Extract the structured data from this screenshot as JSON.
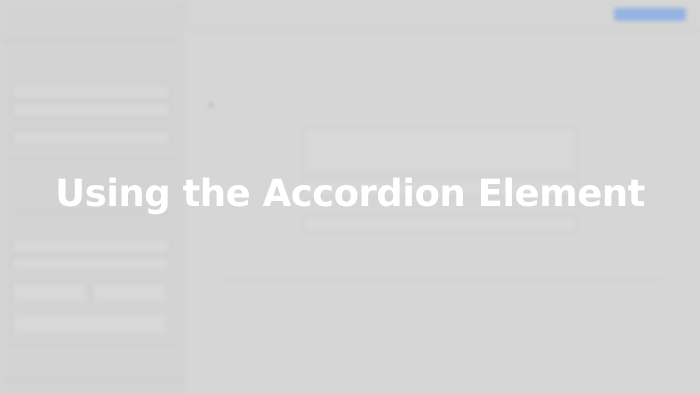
{
  "overlay": {
    "title": "Using the Accordion Element"
  },
  "colors": {
    "background": "#d6d6d6",
    "overlay_text": "#ffffff",
    "cta_button": "#8fb0e3"
  }
}
